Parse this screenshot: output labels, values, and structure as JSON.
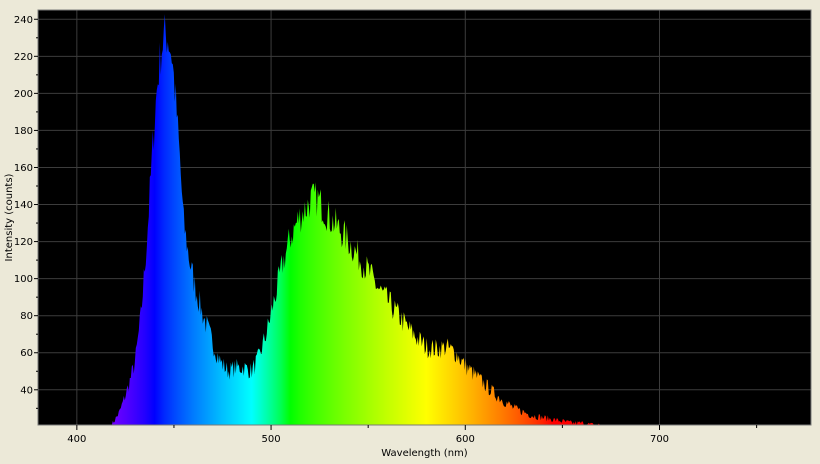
{
  "chart_data": {
    "type": "area",
    "title": "",
    "xlabel": "Wavelength (nm)",
    "ylabel": "Intensity (counts)",
    "xlim": [
      380,
      778
    ],
    "ylim": [
      21,
      245
    ],
    "xticks": [
      400,
      500,
      600,
      700
    ],
    "xtick_labels": [
      "400",
      "500",
      "600",
      "700"
    ],
    "yticks": [
      40,
      60,
      80,
      100,
      120,
      140,
      160,
      180,
      200,
      220,
      240
    ],
    "ytick_labels": [
      "40",
      "60",
      "80",
      "100",
      "120",
      "140",
      "160",
      "180",
      "200",
      "220",
      "240"
    ],
    "grid": true,
    "background_color": "#000000",
    "grid_color": "#3c3c3c",
    "fill": "wavelength-spectrum-colors",
    "series": [
      {
        "x": [
          418,
          422,
          426,
          430,
          433,
          436,
          439,
          441,
          443,
          445,
          447,
          449,
          451,
          453,
          455,
          458,
          461,
          465,
          470,
          474,
          478,
          482,
          486,
          490,
          494,
          498,
          502,
          506,
          510,
          514,
          518,
          521,
          524,
          527,
          530,
          535,
          540,
          545,
          550,
          555,
          560,
          565,
          570,
          575,
          580,
          585,
          590,
          595,
          600,
          605,
          610,
          615,
          620,
          625,
          630,
          635,
          640,
          645,
          650,
          655,
          660,
          665,
          670
        ],
        "y": [
          21,
          28,
          40,
          55,
          80,
          120,
          170,
          200,
          220,
          232,
          230,
          220,
          195,
          165,
          130,
          110,
          95,
          80,
          65,
          55,
          50,
          52,
          52,
          50,
          58,
          72,
          90,
          108,
          122,
          132,
          138,
          143,
          143,
          138,
          133,
          127,
          120,
          112,
          104,
          95,
          88,
          81,
          74,
          68,
          63,
          62,
          63,
          60,
          53,
          48,
          43,
          38,
          34,
          30,
          28,
          26,
          25,
          24,
          23,
          22,
          22,
          21,
          21
        ]
      }
    ]
  }
}
